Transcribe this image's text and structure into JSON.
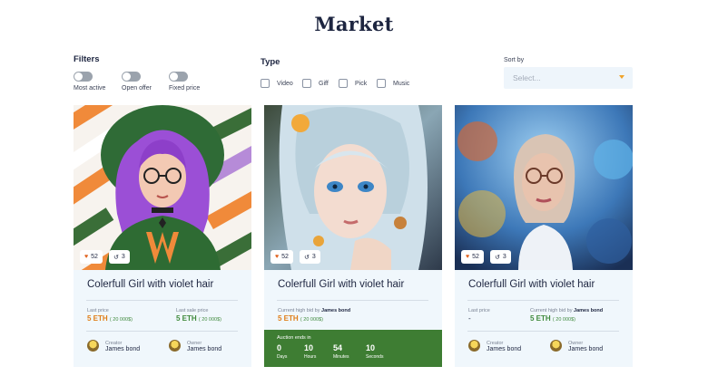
{
  "page": {
    "title": "Market"
  },
  "filters": {
    "heading": "Filters",
    "toggles": [
      {
        "label": "Most active",
        "on": false
      },
      {
        "label": "Open offer",
        "on": false
      },
      {
        "label": "Fixed price",
        "on": false
      }
    ]
  },
  "type_filter": {
    "heading": "Type",
    "options": [
      {
        "label": "Video",
        "checked": false
      },
      {
        "label": "Giff",
        "checked": false
      },
      {
        "label": "Pick",
        "checked": false
      },
      {
        "label": "Music",
        "checked": false
      }
    ]
  },
  "sort": {
    "label": "Sort by",
    "placeholder": "Select..."
  },
  "cards": [
    {
      "title": "Colerfull Girl with violet hair",
      "likes": "52",
      "shares": "3",
      "left_label": "Last price",
      "left_value": "5 ETH",
      "left_sub": "( 20 000$)",
      "right_label": "Last sale price",
      "right_value": "5 ETH",
      "right_sub": "( 20 000$)",
      "creator_role": "Creator",
      "creator_name": "James bond",
      "owner_role": "Owner",
      "owner_name": "James bond"
    },
    {
      "title": "Colerfull Girl with violet hair",
      "likes": "52",
      "shares": "3",
      "bid_label": "Current high bid by",
      "bid_name": "James bond",
      "bid_value": "5 ETH",
      "bid_sub": "( 20 000$)",
      "auction_head": "Auction ends in",
      "countdown": [
        {
          "value": "0",
          "unit": "Days"
        },
        {
          "value": "10",
          "unit": "Hours"
        },
        {
          "value": "54",
          "unit": "Minutes"
        },
        {
          "value": "10",
          "unit": "Seconds"
        }
      ]
    },
    {
      "title": "Colerfull Girl with violet hair",
      "likes": "52",
      "shares": "3",
      "left_label": "Last price",
      "left_value": "-",
      "right_label": "Current high bid by",
      "right_name": "James bond",
      "right_value": "5 ETH",
      "right_sub": "( 20 000$)",
      "creator_role": "Creator",
      "creator_name": "James bond",
      "owner_role": "Owner",
      "owner_name": "James bond"
    }
  ],
  "colors": {
    "accent_orange": "#e07d17",
    "accent_green": "#3e7d33",
    "card_bg": "#f0f7fc",
    "heading": "#1d2540"
  },
  "icons": [
    "heart-icon",
    "share-icon",
    "chevron-down-icon",
    "avatar"
  ]
}
